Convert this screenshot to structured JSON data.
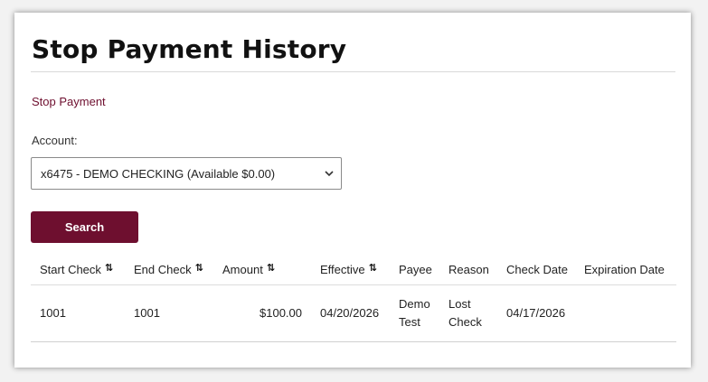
{
  "page": {
    "title": "Stop Payment History",
    "stop_payment_link": "Stop Payment",
    "account_label": "Account:",
    "account_selected": "x6475 - DEMO CHECKING (Available $0.00)",
    "search_button": "Search"
  },
  "icons": {
    "sort": "sort-arrows-icon",
    "select": "chevron-down-icon"
  },
  "colors": {
    "brand": "#6e0f2f"
  },
  "table": {
    "headers": {
      "start_check": "Start Check",
      "end_check": "End Check",
      "amount": "Amount",
      "effective": "Effective",
      "payee": "Payee",
      "reason": "Reason",
      "check_date": "Check Date",
      "expiration_date": "Expiration Date"
    },
    "rows": [
      {
        "start_check": "1001",
        "end_check": "1001",
        "amount": "$100.00",
        "effective": "04/20/2026",
        "payee": "Demo Test",
        "reason": "Lost Check",
        "check_date": "04/17/2026",
        "expiration_date": ""
      }
    ]
  }
}
